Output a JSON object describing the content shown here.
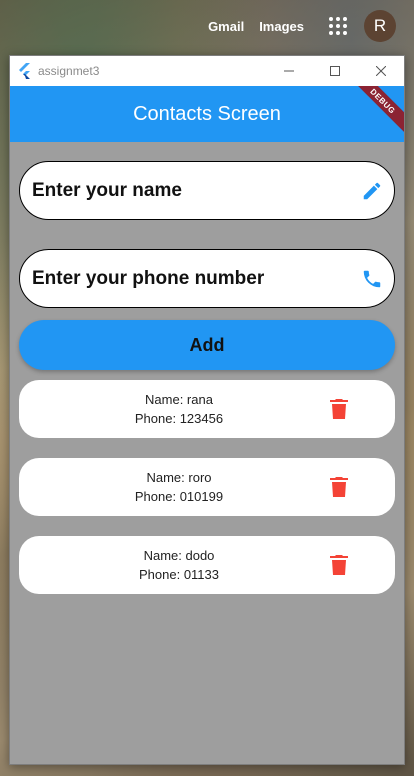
{
  "google_bar": {
    "gmail_label": "Gmail",
    "images_label": "Images",
    "avatar_letter": "R"
  },
  "window": {
    "title": "assignmet3",
    "appbar_title": "Contacts Screen",
    "debug_label": "DEBUG"
  },
  "form": {
    "name_placeholder": "Enter your name",
    "phone_placeholder": "Enter your phone number",
    "add_label": "Add"
  },
  "contacts": [
    {
      "name_line": "Name: rana",
      "phone_line": "Phone: 123456"
    },
    {
      "name_line": "Name: roro",
      "phone_line": "Phone: 010199"
    },
    {
      "name_line": "Name: dodo",
      "phone_line": "Phone: 01133"
    }
  ],
  "colors": {
    "primary": "#2196f3",
    "delete": "#f44336",
    "body_bg": "#9e9e9e",
    "debug_banner": "#8b2333"
  },
  "icons": {
    "name_field": "pencil-icon",
    "phone_field": "phone-icon",
    "contact_action": "trash-icon"
  }
}
